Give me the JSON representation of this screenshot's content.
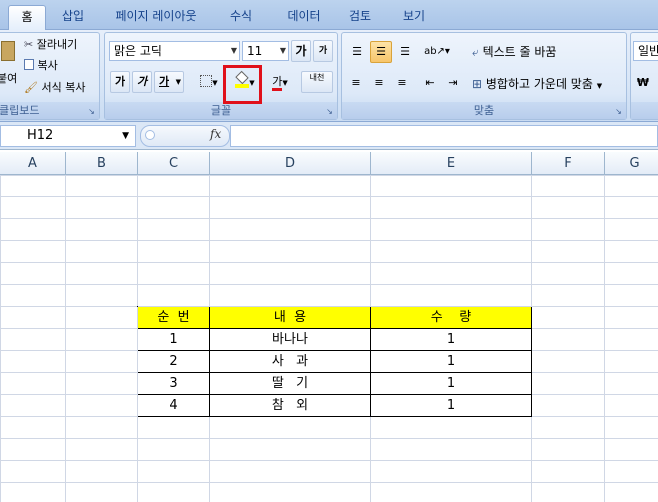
{
  "tabs": [
    "홈",
    "삽입",
    "페이지 레이아웃",
    "수식",
    "데이터",
    "검토",
    "보기"
  ],
  "clipboard": {
    "paste_label": "붙여넣기",
    "cut_label": "잘라내기",
    "copy_label": "복사",
    "format_painter_label": "서식 복사",
    "group_label": "클립보드"
  },
  "font": {
    "font_name": "맑은 고딕",
    "font_size": "11",
    "grow_label": "가",
    "shrink_label": "가",
    "bold_label": "가",
    "italic_label": "가",
    "underline_label": "가",
    "font_color_label": "가",
    "phonetic_label": "내천",
    "group_label": "글꼴"
  },
  "alignment": {
    "wrap_text_label": "텍스트 줄 바꿈",
    "merge_center_label": "병합하고 가운데 맞춤",
    "group_label": "맞춤"
  },
  "number": {
    "format_label": "일반",
    "currency_label": "₩"
  },
  "formula_bar": {
    "name_box": "H12",
    "fx_label": "fx",
    "content": ""
  },
  "columns": [
    "A",
    "B",
    "C",
    "D",
    "E",
    "F",
    "G"
  ],
  "table": {
    "headers": [
      "순  번",
      "내  용",
      "수    량"
    ],
    "rows": [
      [
        "1",
        "바나나",
        "1"
      ],
      [
        "2",
        "사   과",
        "1"
      ],
      [
        "3",
        "딸   기",
        "1"
      ],
      [
        "4",
        "참   외",
        "1"
      ]
    ]
  },
  "colors": {
    "header_fill": "#ffff00",
    "highlight_box": "#e0101a",
    "font_color_underline": "#e0101a"
  }
}
